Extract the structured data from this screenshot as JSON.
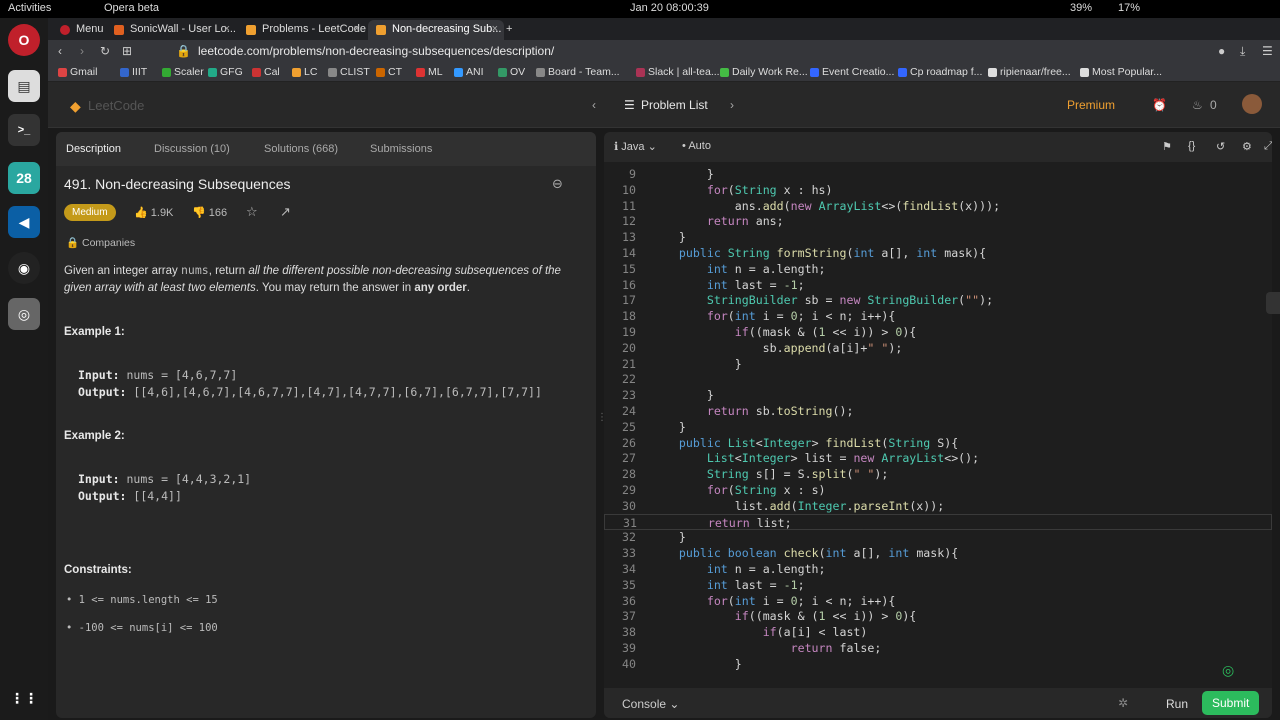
{
  "os": {
    "activities": "Activities",
    "app_menu": "Opera beta",
    "clock": "Jan 20  08:00:39",
    "battery": "39%",
    "cpu": "17%"
  },
  "tabs": [
    {
      "label": "Menu"
    },
    {
      "label": "SonicWall - User Lo..."
    },
    {
      "label": "Problems - LeetCode"
    },
    {
      "label": "Non-decreasing Sub..."
    }
  ],
  "address": {
    "url": "leetcode.com/problems/non-decreasing-subsequences/description/"
  },
  "bookmarks": [
    "Gmail",
    "IIIT",
    "Scaler",
    "GFG",
    "Cal",
    "LC",
    "CLIST",
    "CT",
    "ML",
    "ANI",
    "OV",
    "Board - Team...",
    "Slack | all-tea...",
    "Daily Work Re...",
    "Event Creatio...",
    "Cp roadmap f...",
    "ripienaar/free...",
    "Most Popular..."
  ],
  "nav": {
    "logo": "LeetCode",
    "problem_list": "Problem List",
    "premium": "Premium",
    "points": "0"
  },
  "left_tabs": [
    "Description",
    "Discussion (10)",
    "Solutions (668)",
    "Submissions"
  ],
  "problem": {
    "title": "491. Non-decreasing Subsequences",
    "difficulty": "Medium",
    "likes": "1.9K",
    "dislikes": "166",
    "companies": "Companies",
    "desc_1": "Given an integer array ",
    "desc_code": "nums",
    "desc_2": ", return ",
    "desc_em": "all the different possible non-decreasing subsequences of the given array with at least two elements",
    "desc_3": ". You may return the answer in ",
    "desc_strong": "any order",
    "desc_4": ".",
    "example1_title": "Example 1:",
    "example1_input_label": "Input:",
    "example1_input": "nums = [4,6,7,7]",
    "example1_output_label": "Output:",
    "example1_output": "[[4,6],[4,6,7],[4,6,7,7],[4,7],[4,7,7],[6,7],[6,7,7],[7,7]]",
    "example2_title": "Example 2:",
    "example2_input_label": "Input:",
    "example2_input": "nums = [4,4,3,2,1]",
    "example2_output_label": "Output:",
    "example2_output": "[[4,4]]",
    "constraints_title": "Constraints:",
    "constraint1": "1 <= nums.length <= 15",
    "constraint2": "-100 <= nums[i] <= 100"
  },
  "editor": {
    "language": "Java",
    "mode": "Auto",
    "console": "Console",
    "run": "Run",
    "submit": "Submit"
  },
  "code_lines": [
    {
      "n": "9",
      "t": "        }"
    },
    {
      "n": "10",
      "t": "        for(String x : hs)"
    },
    {
      "n": "11",
      "t": "            ans.add(new ArrayList<>(findList(x)));"
    },
    {
      "n": "12",
      "t": "        return ans;"
    },
    {
      "n": "13",
      "t": "    }"
    },
    {
      "n": "14",
      "t": "    public String formString(int a[], int mask){"
    },
    {
      "n": "15",
      "t": "        int n = a.length;"
    },
    {
      "n": "16",
      "t": "        int last = -1;"
    },
    {
      "n": "17",
      "t": "        StringBuilder sb = new StringBuilder(\"\");"
    },
    {
      "n": "18",
      "t": "        for(int i = 0; i < n; i++){"
    },
    {
      "n": "19",
      "t": "            if((mask & (1 << i)) > 0){"
    },
    {
      "n": "20",
      "t": "                sb.append(a[i]+\" \");"
    },
    {
      "n": "21",
      "t": "            }"
    },
    {
      "n": "22",
      "t": ""
    },
    {
      "n": "23",
      "t": "        }"
    },
    {
      "n": "24",
      "t": "        return sb.toString();"
    },
    {
      "n": "25",
      "t": "    }"
    },
    {
      "n": "26",
      "t": "    public List<Integer> findList(String S){"
    },
    {
      "n": "27",
      "t": "        List<Integer> list = new ArrayList<>();"
    },
    {
      "n": "28",
      "t": "        String s[] = S.split(\" \");"
    },
    {
      "n": "29",
      "t": "        for(String x : s)"
    },
    {
      "n": "30",
      "t": "            list.add(Integer.parseInt(x));"
    },
    {
      "n": "31",
      "t": "        return list;"
    },
    {
      "n": "32",
      "t": "    }"
    },
    {
      "n": "33",
      "t": "    public boolean check(int a[], int mask){"
    },
    {
      "n": "34",
      "t": "        int n = a.length;"
    },
    {
      "n": "35",
      "t": "        int last = -1;"
    },
    {
      "n": "36",
      "t": "        for(int i = 0; i < n; i++){"
    },
    {
      "n": "37",
      "t": "            if((mask & (1 << i)) > 0){"
    },
    {
      "n": "38",
      "t": "                if(a[i] < last)"
    },
    {
      "n": "39",
      "t": "                    return false;"
    },
    {
      "n": "40",
      "t": "            }"
    }
  ]
}
